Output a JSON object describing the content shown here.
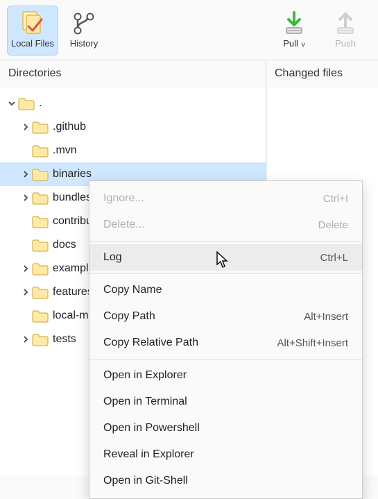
{
  "toolbar": {
    "local_files": "Local Files",
    "history": "History",
    "pull": "Pull",
    "push": "Push"
  },
  "panels": {
    "directories": "Directories",
    "changed_files": "Changed files"
  },
  "tree": {
    "root": ".",
    "items": [
      ".github",
      ".mvn",
      "binaries",
      "bundles",
      "contributing",
      "docs",
      "examples",
      "features",
      "local-maven-repo",
      "tests"
    ]
  },
  "context_menu": {
    "ignore": {
      "label": "Ignore...",
      "accel": "Ctrl+I"
    },
    "delete": {
      "label": "Delete...",
      "accel": "Delete"
    },
    "log": {
      "label": "Log",
      "accel": "Ctrl+L"
    },
    "copy_name": {
      "label": "Copy Name",
      "accel": ""
    },
    "copy_path": {
      "label": "Copy Path",
      "accel": "Alt+Insert"
    },
    "copy_rel": {
      "label": "Copy Relative Path",
      "accel": "Alt+Shift+Insert"
    },
    "open_exp": {
      "label": "Open in Explorer",
      "accel": ""
    },
    "open_term": {
      "label": "Open in Terminal",
      "accel": ""
    },
    "open_ps": {
      "label": "Open in Powershell",
      "accel": ""
    },
    "reveal": {
      "label": "Reveal in Explorer",
      "accel": ""
    },
    "open_git": {
      "label": "Open in Git-Shell",
      "accel": ""
    }
  }
}
